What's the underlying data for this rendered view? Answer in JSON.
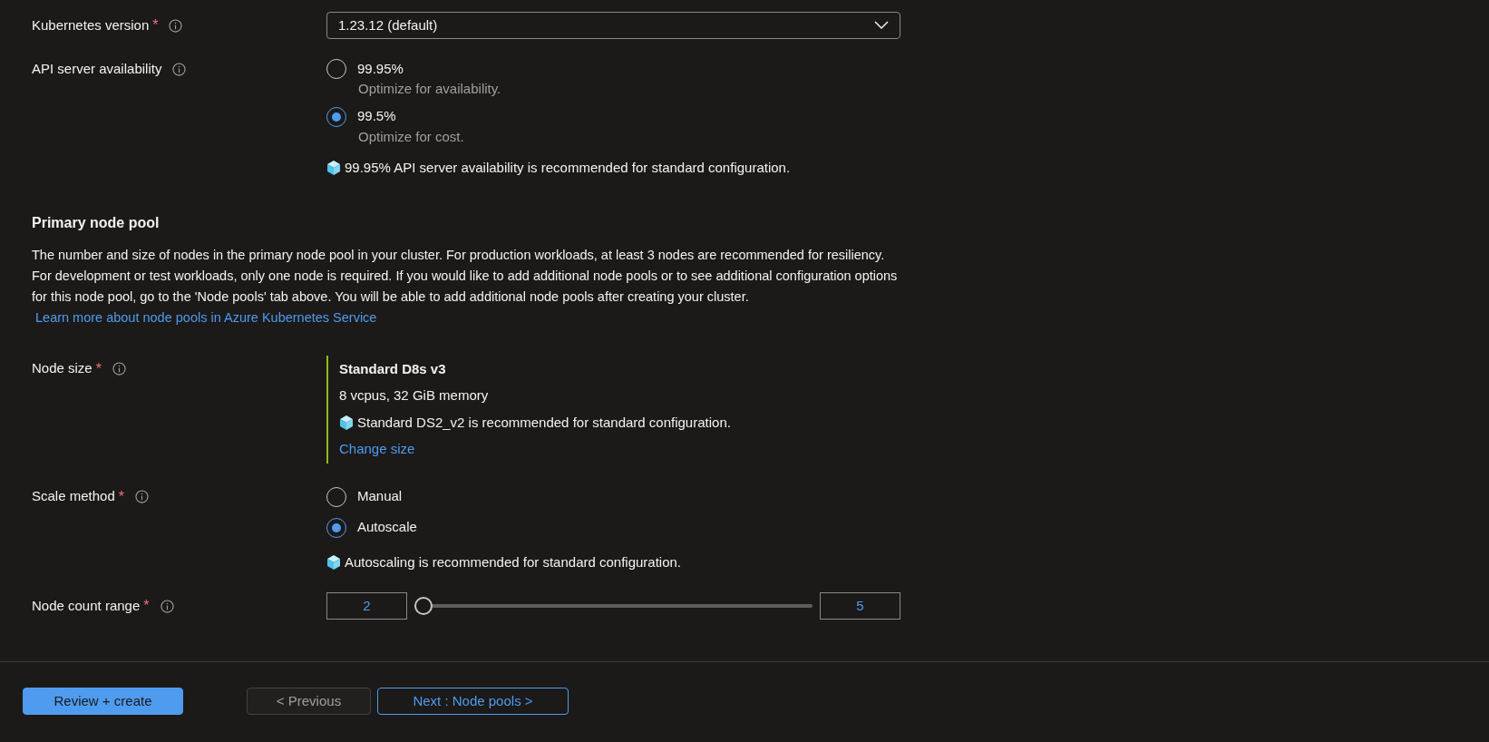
{
  "fields": [
    {
      "kind": "dropdown",
      "label": "Kubernetes version",
      "required_mark": "*",
      "value": "1.23.12 (default)"
    },
    {
      "kind": "radio",
      "label": "API server availability",
      "options": [
        {
          "label": "99.95%",
          "description": "Optimize for availability.",
          "selected": false
        },
        {
          "label": "99.5%",
          "description": "Optimize for cost.",
          "selected": true
        }
      ],
      "note": "99.95% API server availability is recommended for standard configuration."
    }
  ],
  "section": {
    "title": "Primary node pool",
    "description": "The number and size of nodes in the primary node pool in your cluster. For production workloads, at least 3 nodes are recommended for resiliency. For development or test workloads, only one node is required. If you would like to add additional node pools or to see additional configuration options for this node pool, go to the 'Node pools' tab above. You will be able to add additional node pools after creating your cluster.",
    "link": "Learn more about node pools in Azure Kubernetes Service"
  },
  "pool_fields": [
    {
      "kind": "node_size",
      "label": "Node size",
      "required_mark": "*",
      "name": "Standard D8s v3",
      "specs": "8 vcpus, 32 GiB memory",
      "note": "Standard DS2_v2 is recommended for standard configuration.",
      "link": "Change size"
    },
    {
      "kind": "radio",
      "label": "Scale method",
      "required_mark": "*",
      "options": [
        {
          "label": "Manual",
          "selected": false
        },
        {
          "label": "Autoscale",
          "selected": true
        }
      ],
      "note": "Autoscaling is recommended for standard configuration."
    },
    {
      "kind": "range",
      "label": "Node count range",
      "required_mark": "*",
      "min": "2",
      "max": "5",
      "level": 0
    }
  ],
  "footer": [
    {
      "kind": "primary",
      "label": "Review + create",
      "disabled": false
    },
    {
      "kind": "secondary",
      "label": "< Previous",
      "disabled": true
    },
    {
      "kind": "outline",
      "label": "Next : Node pools >",
      "disabled": false
    }
  ]
}
